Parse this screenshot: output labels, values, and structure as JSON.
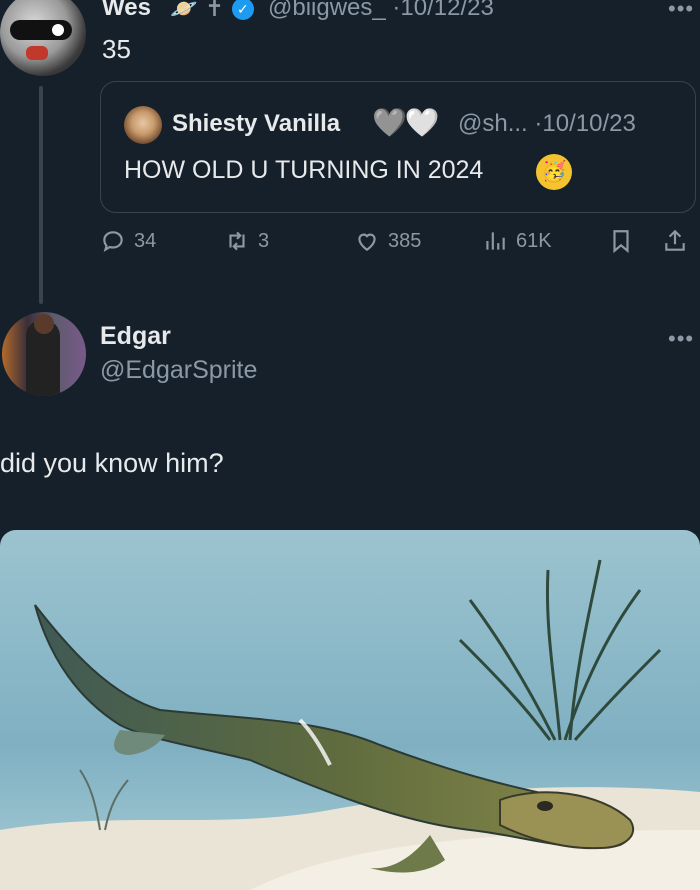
{
  "tweet": {
    "author_name": "Wes",
    "handle": "@biigwes_",
    "date": "10/12/23",
    "text": "35",
    "more_icon": "more-dots-icon"
  },
  "quote": {
    "author_name": "Shiesty Vanilla",
    "handle": "@sh...",
    "date": "10/10/23",
    "text": "HOW OLD U TURNING IN 2024"
  },
  "actions": {
    "replies": "34",
    "retweets": "3",
    "likes": "385",
    "views": "61K"
  },
  "reply": {
    "author_name": "Edgar",
    "handle": "@EdgarSprite",
    "text": "did you know him?"
  },
  "colors": {
    "background": "#15202b",
    "text": "#e7e9ea",
    "muted": "#8b98a5",
    "verified": "#1d9bf0",
    "border": "#38444d"
  }
}
